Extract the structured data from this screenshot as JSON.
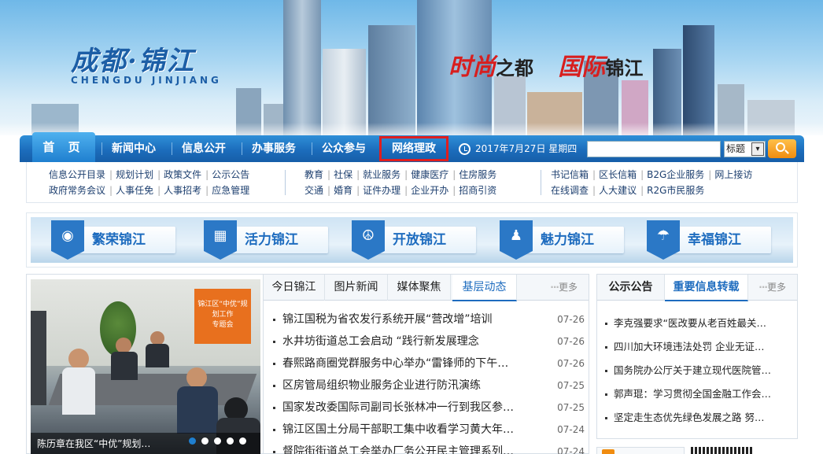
{
  "banner": {
    "logo_cn": "成都·锦江",
    "logo_en": "CHENGDU JINJIANG",
    "slogan_part1": "时尚",
    "slogan_part2": "之都",
    "slogan_part3": "国际",
    "slogan_part4": "锦江"
  },
  "nav": {
    "items": [
      "首 页",
      "新闻中心",
      "信息公开",
      "办事服务",
      "公众参与",
      "网络理政"
    ],
    "date": "2017年7月27日 星期四",
    "search_placeholder": "",
    "search_select": "标题"
  },
  "subnav": {
    "group1": {
      "row1": [
        "信息公开目录",
        "规划计划",
        "政策文件",
        "公示公告"
      ],
      "row2": [
        "政府常务会议",
        "人事任免",
        "人事招考",
        "应急管理"
      ]
    },
    "group2": {
      "row1": [
        "教育",
        "社保",
        "就业服务",
        "健康医疗",
        "住房服务"
      ],
      "row2": [
        "交通",
        "婚育",
        "证件办理",
        "企业开办",
        "招商引资"
      ]
    },
    "group3": {
      "row1": [
        "书记信箱",
        "区长信箱",
        "B2G企业服务",
        "网上接访"
      ],
      "row2": [
        "在线调查",
        "人大建议",
        "R2G市民服务"
      ]
    }
  },
  "features": [
    "繁荣锦江",
    "活力锦江",
    "开放锦江",
    "魅力锦江",
    "幸福锦江"
  ],
  "slideshow": {
    "caption": "陈历章在我区“中优”规划…",
    "dot_count": 5,
    "active_dot": 0,
    "sign_text": "锦江区“中优”规划工作\n专题会"
  },
  "news": {
    "tabs": [
      "今日锦江",
      "图片新闻",
      "媒体聚焦",
      "基层动态"
    ],
    "active_tab": 3,
    "more": "更多",
    "items": [
      {
        "title": "锦江国税为省农发行系统开展“营改增”培训",
        "date": "07-26"
      },
      {
        "title": "水井坊街道总工会启动 “践行新发展理念",
        "date": "07-26"
      },
      {
        "title": "春熙路商圈党群服务中心举办“雷锋师的下午…",
        "date": "07-26"
      },
      {
        "title": "区房管局组织物业服务企业进行防汛演练",
        "date": "07-25"
      },
      {
        "title": "国家发改委国际司副司长张林冲一行到我区参…",
        "date": "07-25"
      },
      {
        "title": "锦江区国土分局干部职工集中收看学习黄大年…",
        "date": "07-24"
      },
      {
        "title": "督院街街道总工会举办厂务公开民主管理系列…",
        "date": "07-24"
      }
    ]
  },
  "notice": {
    "tabs": [
      "公示公告",
      "重要信息转载"
    ],
    "active_tab": 1,
    "more": "更多",
    "items": [
      "李克强要求“医改要从老百姓最关…",
      "四川加大环境违法处罚 企业无证…",
      "国务院办公厅关于建立现代医院管…",
      "郭声琨：学习贯彻全国金融工作会…",
      "坚定走生态优先绿色发展之路 努…"
    ]
  },
  "colors": {
    "nav_blue": "#1c6dbc",
    "accent_blue": "#1e6cbf",
    "highlight_red": "#e01e1e",
    "search_orange": "#f08c10"
  }
}
